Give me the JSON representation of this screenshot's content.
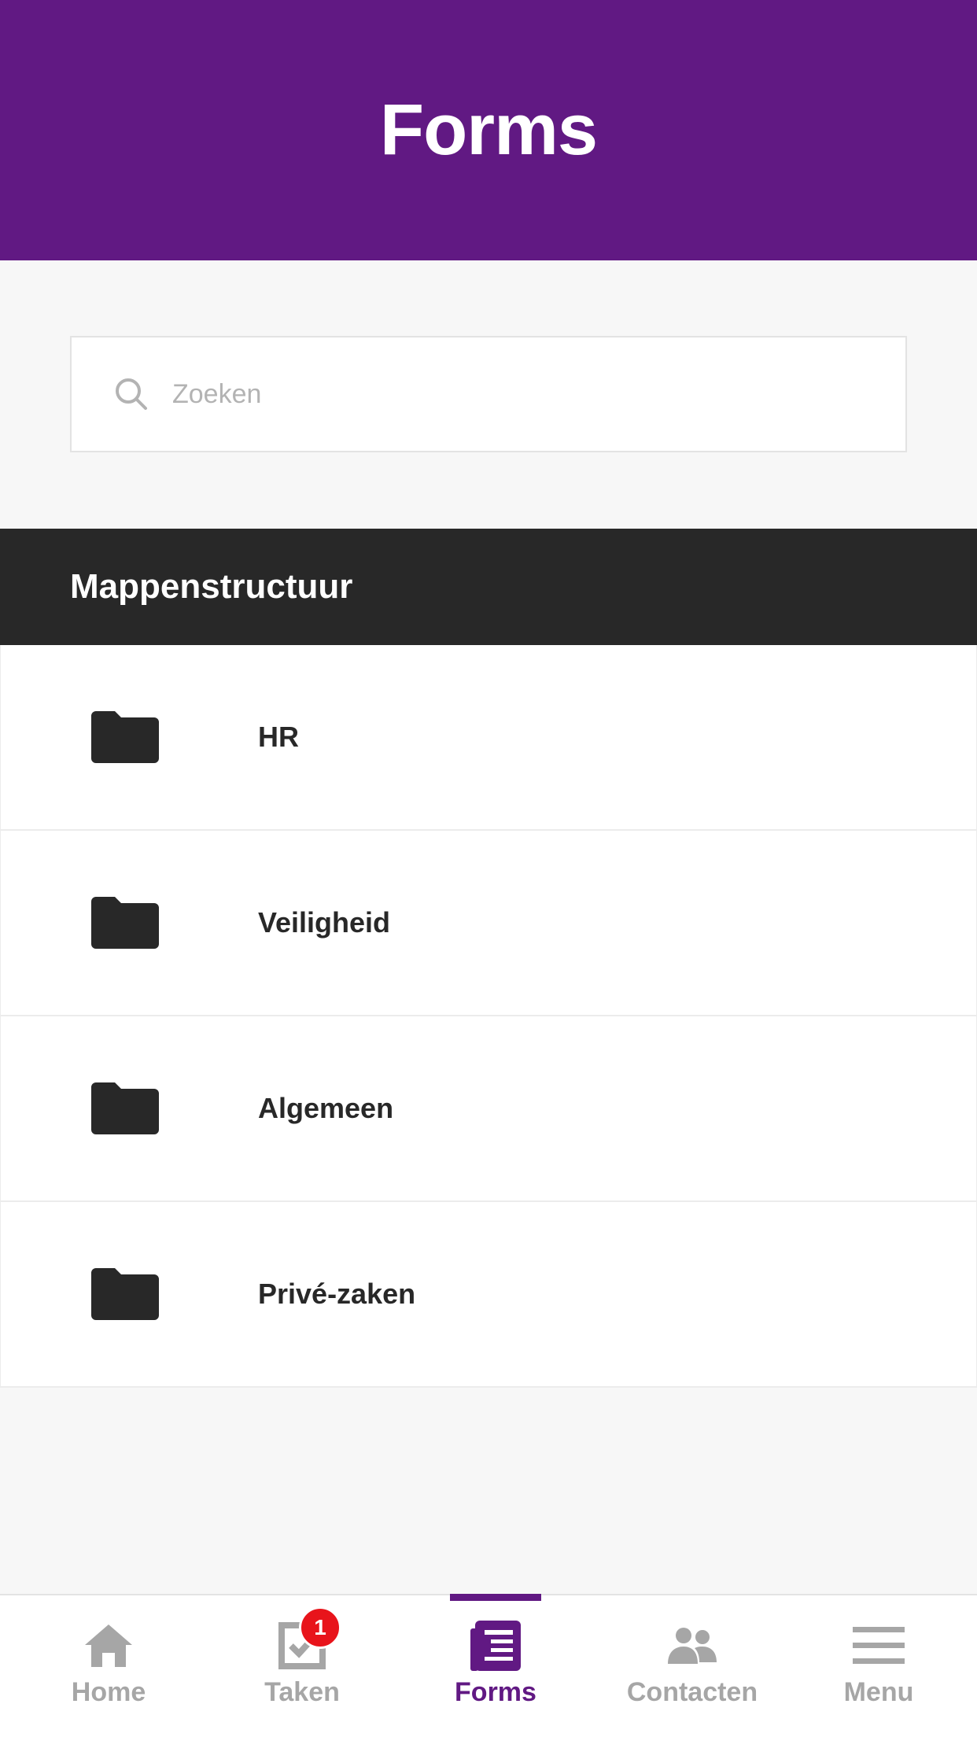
{
  "header": {
    "title": "Forms"
  },
  "search": {
    "placeholder": "Zoeken"
  },
  "section": {
    "title": "Mappenstructuur"
  },
  "folders": [
    {
      "label": "HR"
    },
    {
      "label": "Veiligheid"
    },
    {
      "label": "Algemeen"
    },
    {
      "label": "Privé-zaken"
    }
  ],
  "tabbar": {
    "items": [
      {
        "label": "Home",
        "icon": "home-icon"
      },
      {
        "label": "Taken",
        "icon": "tasks-icon",
        "badge": "1"
      },
      {
        "label": "Forms",
        "icon": "forms-icon",
        "active": true
      },
      {
        "label": "Contacten",
        "icon": "contacts-icon"
      },
      {
        "label": "Menu",
        "icon": "menu-icon"
      }
    ]
  },
  "colors": {
    "brand": "#611983",
    "section_bg": "#282828",
    "badge": "#e8141b",
    "inactive": "#a6a6a6"
  }
}
